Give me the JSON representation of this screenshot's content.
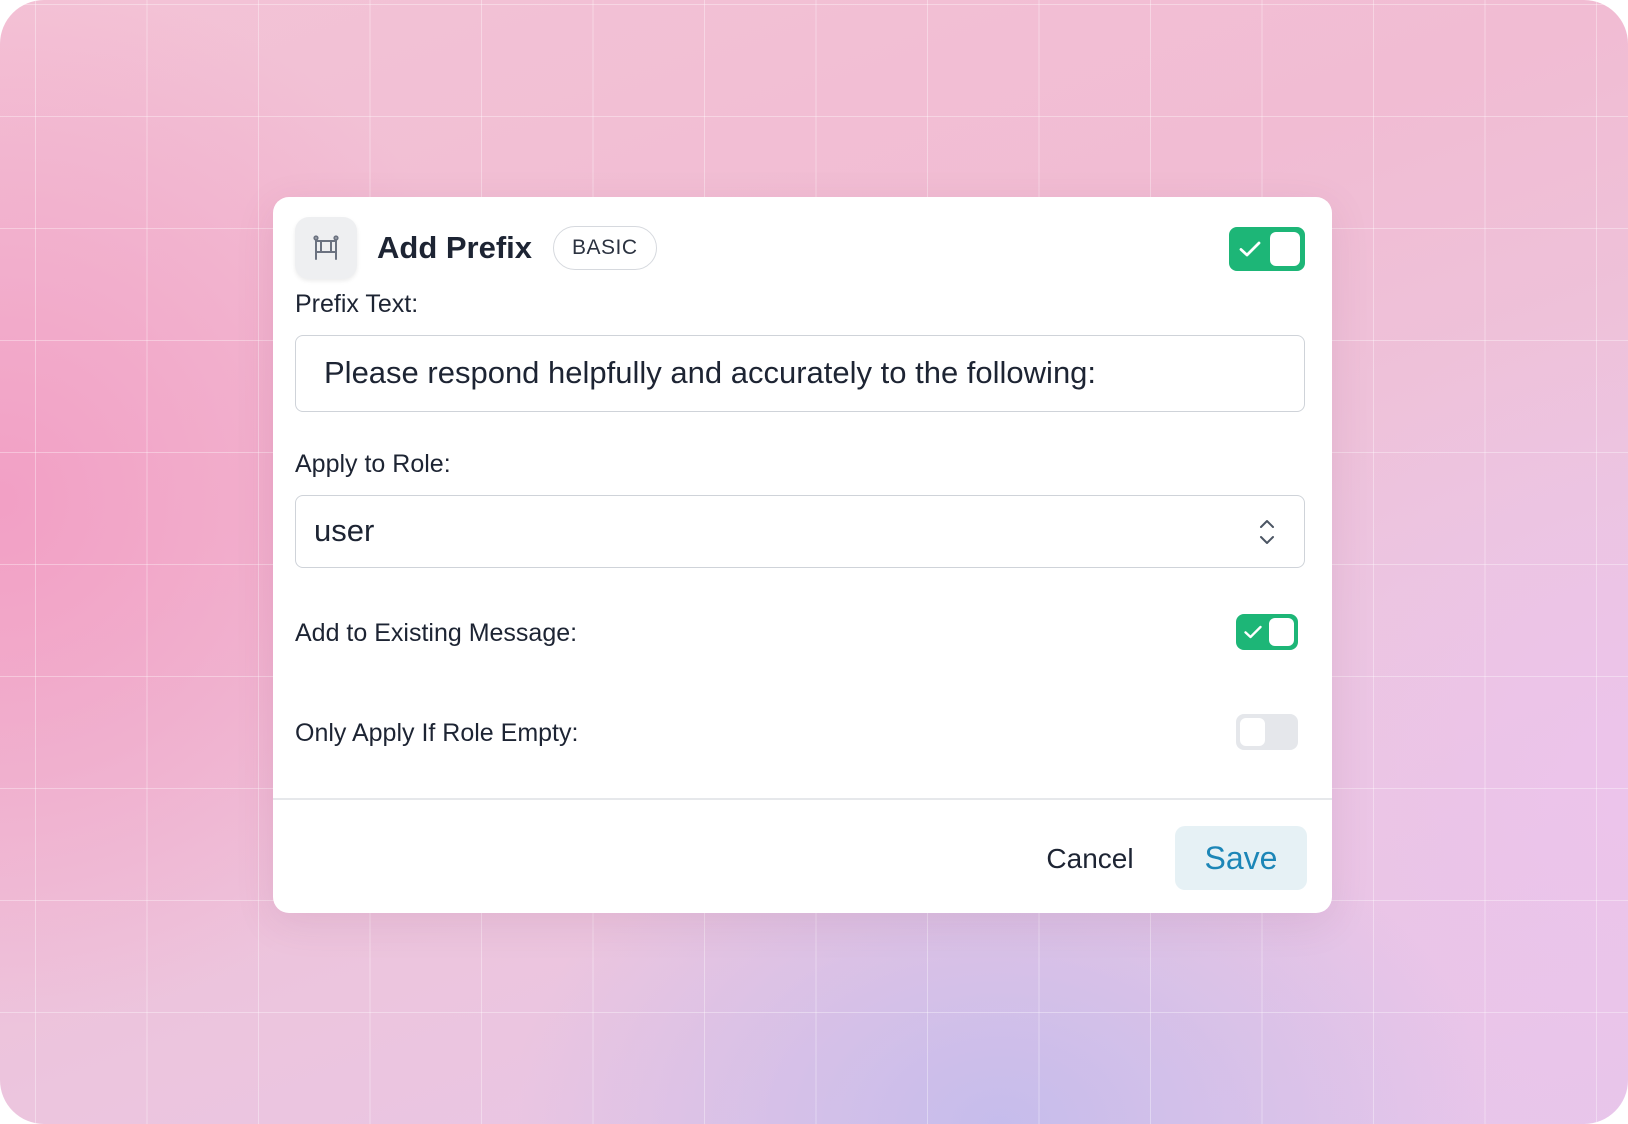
{
  "dialog": {
    "title": "Add Prefix",
    "badge": "BASIC",
    "icon": "arch-frame-icon",
    "enabled": true
  },
  "prefix_text": {
    "label": "Prefix Text:",
    "value": "Please respond helpfully and accurately to the following:"
  },
  "apply_to_role": {
    "label": "Apply to Role:",
    "selected": "user"
  },
  "add_to_existing": {
    "label": "Add to Existing Message:",
    "checked": true
  },
  "only_if_empty": {
    "label": "Only Apply If Role Empty:",
    "checked": false
  },
  "footer": {
    "cancel_label": "Cancel",
    "save_label": "Save"
  },
  "colors": {
    "toggle_on": "#1db677",
    "toggle_off": "#e5e7eb",
    "save_text": "#1c86b7",
    "save_bg": "#e6f1f5"
  }
}
